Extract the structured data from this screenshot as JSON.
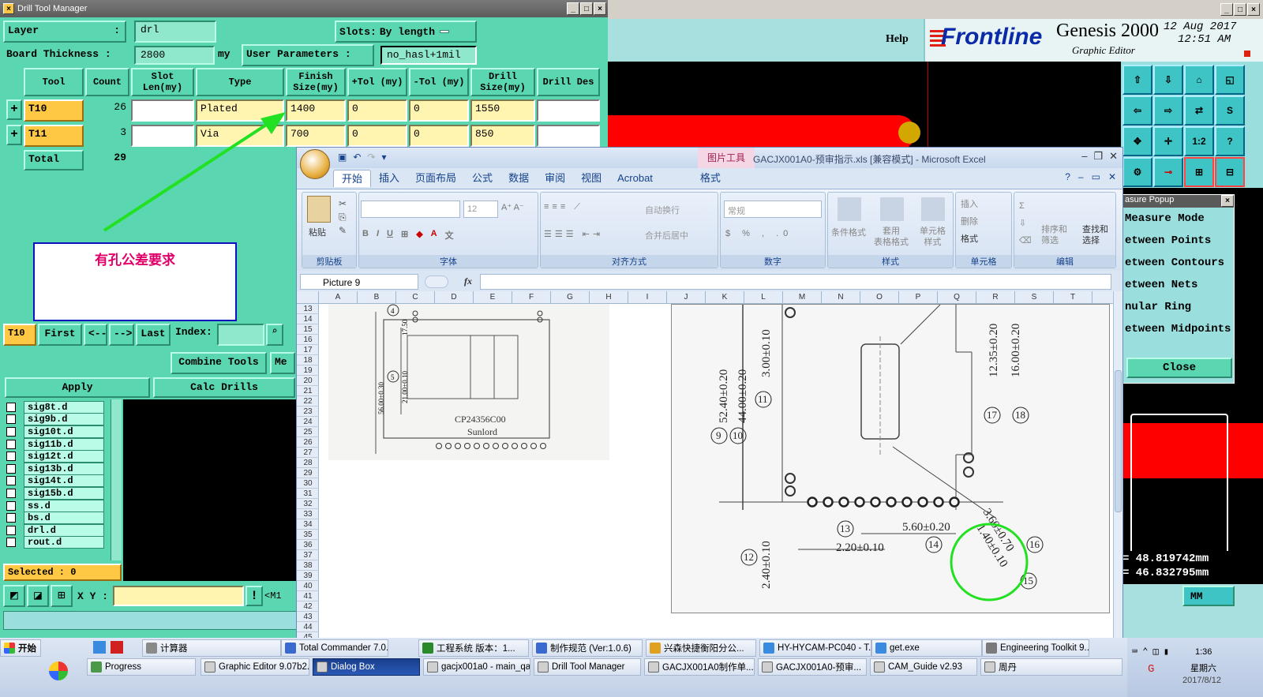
{
  "drill_tool_manager": {
    "title": "Drill Tool Manager",
    "layer_label": "Layer",
    "layer_colon": ":",
    "layer_value": "drl",
    "slots_label": "Slots:",
    "slots_value": "By length",
    "board_thickness_label": "Board Thickness :",
    "board_thickness_value": "2800",
    "board_thickness_unit": "my",
    "user_params_label": "User Parameters :",
    "user_params_value": "no_hasl+1mil",
    "columns": [
      "Tool",
      "Count",
      "Slot Len(my)",
      "Type",
      "Finish Size(my)",
      "+Tol (my)",
      "-Tol (my)",
      "Drill Size(my)",
      "Drill Des"
    ],
    "rows": [
      {
        "tool": "T10",
        "count": "26",
        "slot_len": "",
        "type": "Plated",
        "finish": "1400",
        "ptol": "0",
        "ntol": "0",
        "drill": "1550",
        "des": ""
      },
      {
        "tool": "T11",
        "count": "3",
        "slot_len": "",
        "type": "Via",
        "finish": "700",
        "ptol": "0",
        "ntol": "0",
        "drill": "850",
        "des": ""
      }
    ],
    "total_label": "Total",
    "total_count": "29",
    "annotation_text": "有孔公差要求",
    "nav": {
      "current": "T10",
      "first": "First",
      "prev": "<--",
      "next": "-->",
      "last": "Last",
      "index_label": "Index:"
    },
    "combine_tools": "Combine Tools",
    "me_label": "Me",
    "apply": "Apply",
    "calc_drills": "Calc Drills",
    "layers": [
      "sig8t.d",
      "sig9b.d",
      "sig10t.d",
      "sig11b.d",
      "sig12t.d",
      "sig13b.d",
      "sig14t.d",
      "sig15b.d",
      "ss.d",
      "bs.d",
      "drl.d",
      "rout.d"
    ],
    "selected": "Selected : 0",
    "xy_label": "X Y :",
    "m1_label": "<M1"
  },
  "genesis": {
    "help": "Help",
    "brand": "Frontline",
    "product": "Genesis 2000",
    "subtitle": "Graphic Editor",
    "date": "12 Aug 2017",
    "time": "12:51 AM",
    "toolbar_labels": [
      "1:2",
      "?"
    ],
    "measure_popup_title": "asure Popup",
    "measure_items": [
      "Measure Mode",
      "etween Points",
      "etween Contours",
      "etween Nets",
      "nular Ring",
      "etween Midpoints"
    ],
    "close": "Close",
    "coord_x": "= 48.819742mm",
    "coord_y": "= 46.832795mm",
    "unit": "MM"
  },
  "excel": {
    "context_tab": "图片工具",
    "title": "GACJX001A0-预审指示.xls  [兼容模式] - Microsoft Excel",
    "tabs": [
      "开始",
      "插入",
      "页面布局",
      "公式",
      "数据",
      "审阅",
      "视图",
      "Acrobat",
      "格式"
    ],
    "groups": [
      "剪贴板",
      "字体",
      "对齐方式",
      "数字",
      "样式",
      "单元格",
      "编辑"
    ],
    "paste": "粘贴",
    "font_size": "12",
    "wrap": "自动换行",
    "merge": "合并后居中",
    "number_format": "常规",
    "style_buttons": [
      "条件格式",
      "套用\n表格格式",
      "单元格\n样式"
    ],
    "cell_buttons": [
      "插入",
      "删除",
      "格式"
    ],
    "edit_buttons": [
      "排序和\n筛选",
      "查找和\n选择"
    ],
    "name_box": "Picture 9",
    "fx": "fx",
    "col_headers": [
      "A",
      "B",
      "C",
      "D",
      "E",
      "F",
      "G",
      "H",
      "I",
      "J",
      "K",
      "L",
      "M",
      "N",
      "O",
      "P",
      "Q",
      "R",
      "S",
      "T"
    ],
    "row_start": 13,
    "row_end": 45,
    "drawing_left": {
      "part": "CP24356C00",
      "maker": "Sunlord",
      "dims": [
        "17.50",
        "56.00±0.30",
        "21.00±0.10"
      ],
      "circles": [
        "4",
        "5"
      ]
    },
    "drawing_right": {
      "dims": [
        "52.40±0.20",
        "44.00±0.20",
        "3.00±0.10",
        "12.35±0.20",
        "16.00±0.20",
        "5.60±0.20",
        "2.20±0.10",
        "2.40±0.10",
        "1.40±0.10",
        "3.60±0.70"
      ],
      "circles": [
        "9",
        "10",
        "11",
        "12",
        "13",
        "14",
        "15",
        "16",
        "17",
        "18"
      ]
    }
  },
  "taskbar": {
    "start": "开始",
    "row1": [
      "Progress",
      "计算器",
      "Total Commander 7.0...",
      "工程系统  版本：1...",
      "制作规范 (Ver:1.0.6)",
      "兴森快捷衡阳分公...",
      "HY-HYCAM-PC040 - T...",
      "get.exe",
      "Engineering Toolkit 9...."
    ],
    "row2": [
      "Graphic Editor 9.07b2...",
      "Dialog Box",
      "gacjx001a0 - main_qa",
      "Drill Tool Manager",
      "GACJX001A0制作单...",
      "GACJX001A0-预审...",
      "CAM_Guide v2.93",
      "周丹"
    ],
    "clock": "1:36",
    "weekday": "星期六",
    "date": "2017/8/12"
  }
}
